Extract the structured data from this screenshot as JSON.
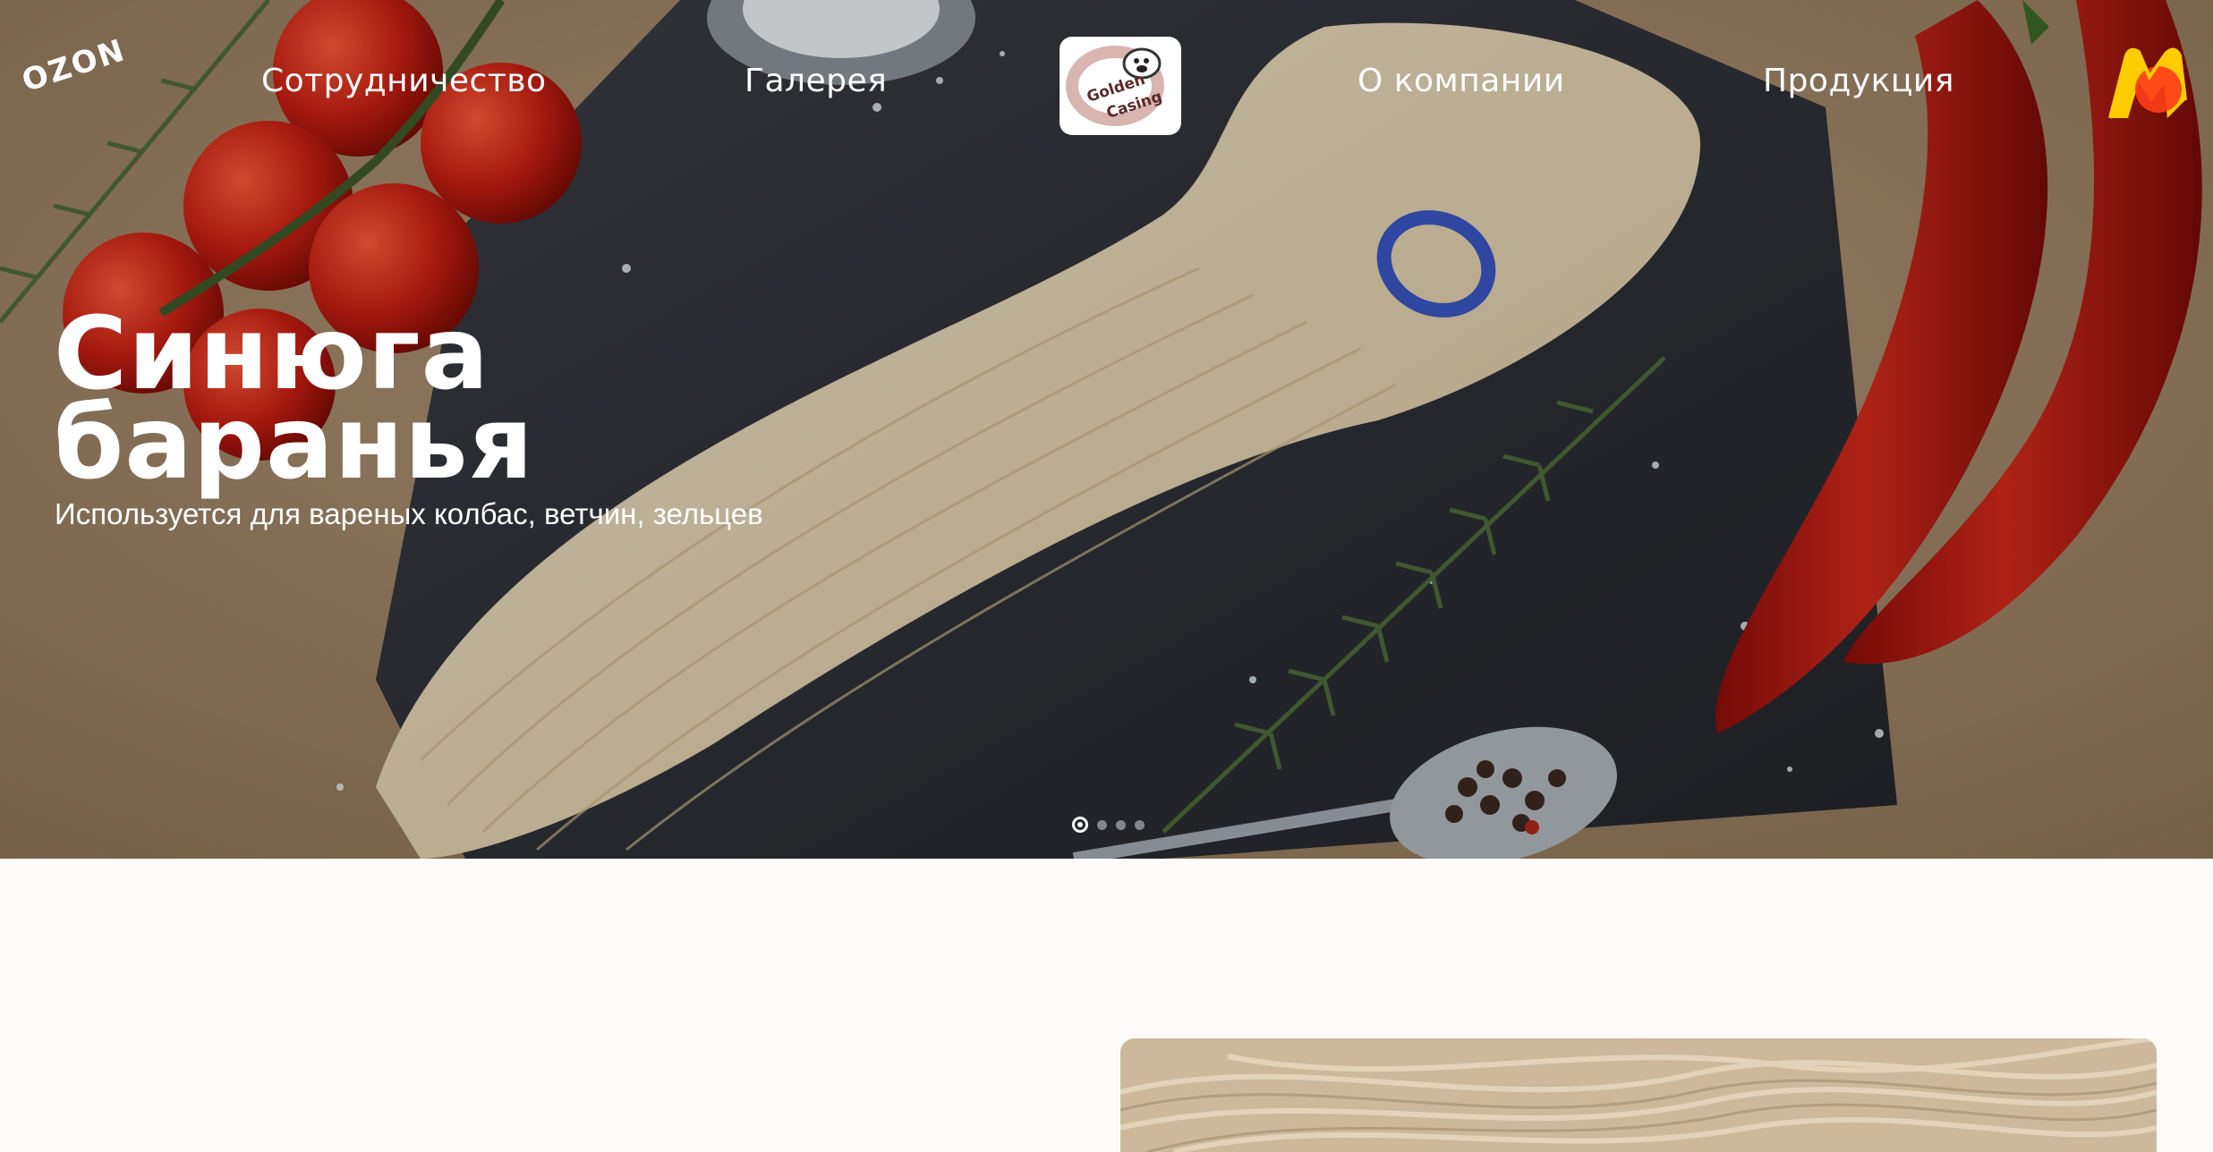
{
  "header": {
    "ozon_label": "OZON",
    "nav": [
      {
        "label": "Сотрудничество"
      },
      {
        "label": "Галерея"
      },
      {
        "label": "О компании"
      },
      {
        "label": "Продукция"
      }
    ],
    "logo_text_top": "Golden",
    "logo_text_bottom": "Casing",
    "market_icon": "yandex-market-icon"
  },
  "hero": {
    "title_line1": "Синюга",
    "title_line2": "баранья",
    "subtitle": "Используется для вареных колбас, ветчин, зельцев",
    "slides_total": 4,
    "active_slide": 1
  },
  "colors": {
    "accent_red": "#c8261c",
    "market_yellow": "#ffcc00",
    "market_red": "#ff3d1a",
    "page_bg": "#fcfbfa"
  }
}
